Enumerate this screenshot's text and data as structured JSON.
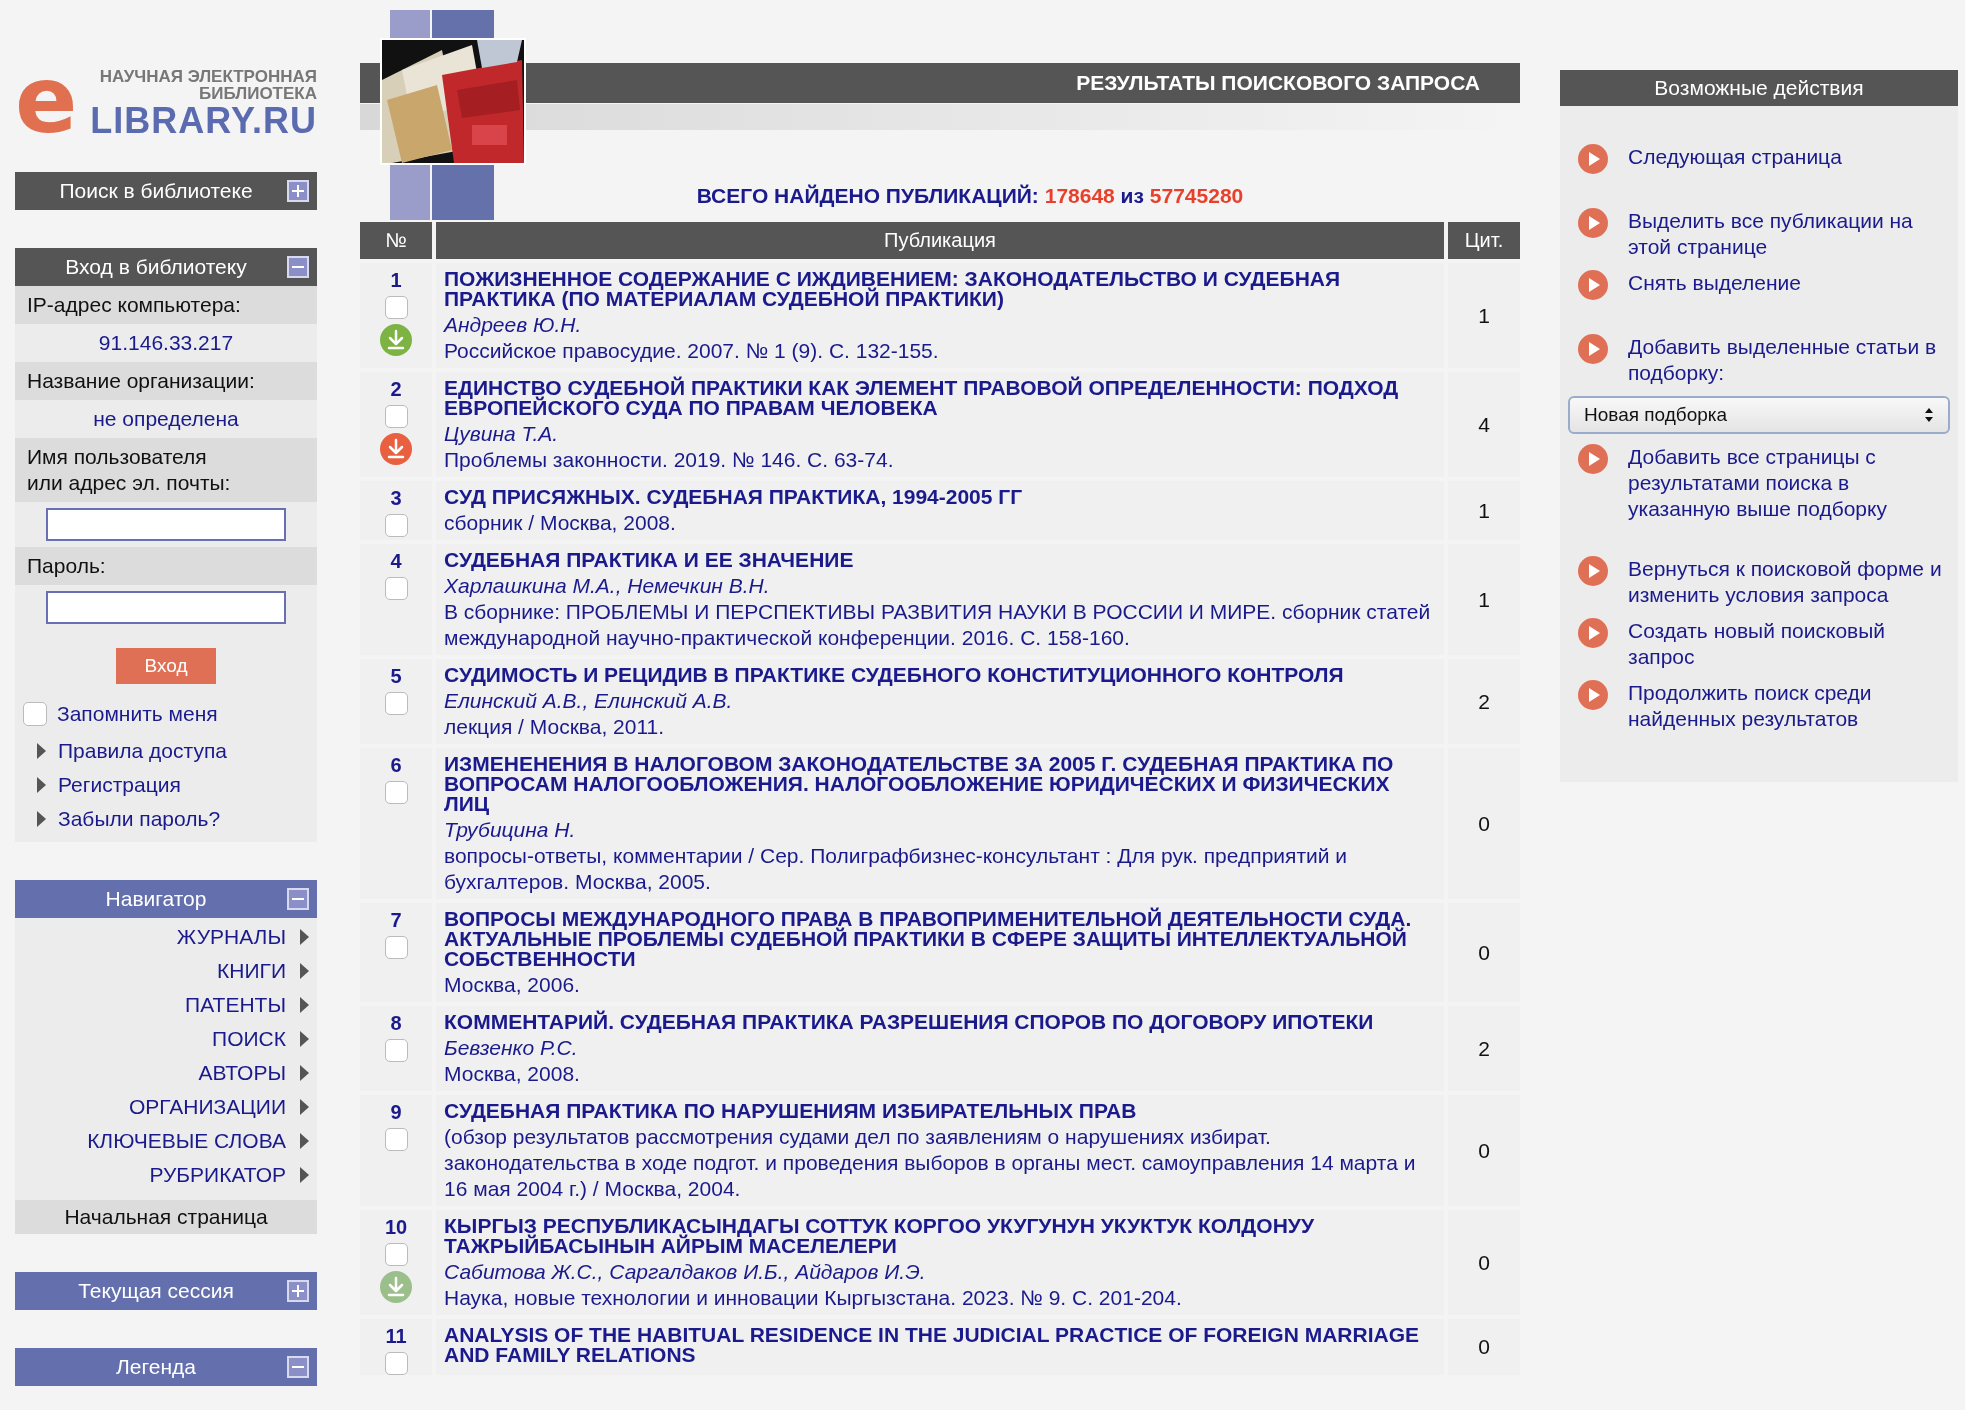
{
  "logo": {
    "letter": "e",
    "line1": "НАУЧНАЯ ЭЛЕКТРОННАЯ",
    "line2": "БИБЛИОТЕКА",
    "name": "LIBRARY.RU"
  },
  "search_panel": {
    "title": "Поиск в библиотеке",
    "expanded": false
  },
  "login_panel": {
    "title": "Вход в библиотеку",
    "expanded": true,
    "fields": [
      {
        "kind": "label",
        "text": "IP-адрес компьютера:"
      },
      {
        "kind": "value",
        "text": "91.146.33.217"
      },
      {
        "kind": "label",
        "text": "Название организации:"
      },
      {
        "kind": "value",
        "text": "не определена"
      },
      {
        "kind": "label",
        "text": "Имя пользователя\nили адрес эл. почты:"
      },
      {
        "kind": "input"
      },
      {
        "kind": "label",
        "text": "Пароль:"
      },
      {
        "kind": "input"
      }
    ],
    "button": "Вход",
    "remember": {
      "label": "Запомнить меня",
      "checked": false
    },
    "links": [
      "Правила доступа",
      "Регистрация",
      "Забыли пароль?"
    ]
  },
  "navigator": {
    "title": "Навигатор",
    "expanded": true,
    "items": [
      "ЖУРНАЛЫ",
      "КНИГИ",
      "ПАТЕНТЫ",
      "ПОИСК",
      "АВТОРЫ",
      "ОРГАНИЗАЦИИ",
      "КЛЮЧЕВЫЕ СЛОВА",
      "РУБРИКАТОР"
    ],
    "home": "Начальная страница"
  },
  "session_panel": {
    "title": "Текущая сессия",
    "expanded": false
  },
  "legend_panel": {
    "title": "Легенда",
    "expanded": true
  },
  "results": {
    "title": "РЕЗУЛЬТАТЫ ПОИСКОВОГО ЗАПРОСА",
    "total_label": "ВСЕГО НАЙДЕНО ПУБЛИКАЦИЙ:",
    "found": "178648",
    "of": "из",
    "total": "57745280",
    "columns": [
      "№",
      "Публикация",
      "Цит."
    ],
    "rows": [
      {
        "num": "1",
        "checked": false,
        "download": {
          "color": "#7cb342"
        },
        "title": "ПОЖИЗНЕННОЕ СОДЕРЖАНИЕ С ИЖДИВЕНИЕМ: ЗАКОНОДАТЕЛЬСТВО И СУДЕБНАЯ ПРАКТИКА (ПО МАТЕРИАЛАМ СУДЕБНОЙ ПРАКТИКИ)",
        "authors": "Андреев Ю.Н.",
        "source": "Российское правосудие. 2007. № 1 (9). С. 132-155.",
        "cit": "1"
      },
      {
        "num": "2",
        "checked": false,
        "download": {
          "color": "#e8603f"
        },
        "title": "ЕДИНСТВО СУДЕБНОЙ ПРАКТИКИ КАК ЭЛЕМЕНТ ПРАВОВОЙ ОПРЕДЕЛЕННОСТИ: ПОДХОД ЕВРОПЕЙСКОГО СУДА ПО ПРАВАМ ЧЕЛОВЕКА",
        "authors": "Цувина Т.А.",
        "source": "Проблемы законности. 2019. № 146. С. 63-74.",
        "cit": "4"
      },
      {
        "num": "3",
        "checked": false,
        "title": "СУД ПРИСЯЖНЫХ. СУДЕБНАЯ ПРАКТИКА, 1994-2005 ГГ",
        "source": "сборник / Москва, 2008.",
        "cit": "1"
      },
      {
        "num": "4",
        "checked": false,
        "title": "СУДЕБНАЯ ПРАКТИКА И ЕЕ ЗНАЧЕНИЕ",
        "authors": "Харлашкина М.А., Немечкин В.Н.",
        "source": "В сборнике: ПРОБЛЕМЫ И ПЕРСПЕКТИВЫ РАЗВИТИЯ НАУКИ В РОССИИ И МИРЕ. сборник статей международной научно-практической конференции. 2016. С. 158-160.",
        "cit": "1"
      },
      {
        "num": "5",
        "checked": false,
        "title": "СУДИМОСТЬ И РЕЦИДИВ В ПРАКТИКЕ СУДЕБНОГО КОНСТИТУЦИОННОГО КОНТРОЛЯ",
        "authors": "Елинский А.В., Елинский А.В.",
        "source": "лекция / Москва, 2011.",
        "cit": "2"
      },
      {
        "num": "6",
        "checked": false,
        "title": "ИЗМЕНЕНЕНИЯ В НАЛОГОВОМ ЗАКОНОДАТЕЛЬСТВЕ ЗА 2005 Г. СУДЕБНАЯ ПРАКТИКА ПО ВОПРОСАМ НАЛОГООБЛОЖЕНИЯ. НАЛОГООБЛОЖЕНИЕ ЮРИДИЧЕСКИХ И ФИЗИЧЕСКИХ ЛИЦ",
        "authors": "Трубицина Н.",
        "source": "вопросы-ответы, комментарии / Сер. Полиграфбизнес-консультант : Для рук. предприятий и бухгалтеров. Москва, 2005.",
        "cit": "0"
      },
      {
        "num": "7",
        "checked": false,
        "title": "ВОПРОСЫ МЕЖДУНАРОДНОГО ПРАВА В ПРАВОПРИМЕНИТЕЛЬНОЙ ДЕЯТЕЛЬНОСТИ СУДА. АКТУАЛЬНЫЕ ПРОБЛЕМЫ СУДЕБНОЙ ПРАКТИКИ В СФЕРЕ ЗАЩИТЫ ИНТЕЛЛЕКТУАЛЬНОЙ СОБСТВЕННОСТИ",
        "source": "Москва, 2006.",
        "cit": "0"
      },
      {
        "num": "8",
        "checked": false,
        "title": "КОММЕНТАРИЙ. СУДЕБНАЯ ПРАКТИКА РАЗРЕШЕНИЯ СПОРОВ ПО ДОГОВОРУ ИПОТЕКИ",
        "authors": "Бевзенко Р.С.",
        "source": "Москва, 2008.",
        "cit": "2"
      },
      {
        "num": "9",
        "checked": false,
        "title": "СУДЕБНАЯ ПРАКТИКА ПО НАРУШЕНИЯМ ИЗБИРАТЕЛЬНЫХ ПРАВ",
        "source": "(обзор результатов рассмотрения судами дел по заявлениям о нарушениях избират. законодательства в ходе подгот. и проведения выборов в органы мест. самоуправления 14 марта и 16 мая 2004 г.) / Москва, 2004.",
        "cit": "0"
      },
      {
        "num": "10",
        "checked": false,
        "download": {
          "color": "#9bbf8a"
        },
        "title": "КЫРГЫЗ РЕСПУБЛИКАСЫНДАГЫ СОТТУК КОРГОО УКУГУНУН УКУКТУК КОЛДОНУУ ТАЖРЫЙБАСЫНЫН АЙРЫМ МАСЕЛЕЛЕРИ",
        "authors": "Сабитова Ж.С., Саргалдаков И.Б., Айдаров И.Э.",
        "source": "Наука, новые технологии и инновации Кыргызстана. 2023. № 9. С. 201-204.",
        "cit": "0"
      },
      {
        "num": "11",
        "checked": false,
        "title": "ANALYSIS OF THE HABITUAL RESIDENCE IN THE JUDICIAL PRACTICE OF FOREIGN MARRIAGE AND FAMILY RELATIONS",
        "cit": "0"
      }
    ]
  },
  "actions": {
    "title": "Возможные действия",
    "groups": [
      [
        {
          "kind": "link",
          "text": "Следующая страница"
        }
      ],
      [
        {
          "kind": "link",
          "text": "Выделить все публикации на этой странице"
        },
        {
          "kind": "link",
          "text": "Снять выделение"
        }
      ],
      [
        {
          "kind": "link",
          "text": "Добавить выделенные статьи в подборку:"
        },
        {
          "kind": "select",
          "text": "Новая подборка"
        },
        {
          "kind": "link",
          "text": "Добавить все страницы с результатами поиска в указанную выше подборку"
        }
      ],
      [
        {
          "kind": "link",
          "text": "Вернуться к поисковой форме и изменить условия запроса"
        },
        {
          "kind": "link",
          "text": "Создать новый поисковый запрос"
        },
        {
          "kind": "link",
          "text": "Продолжить поиск среди найденных результатов"
        }
      ]
    ]
  }
}
